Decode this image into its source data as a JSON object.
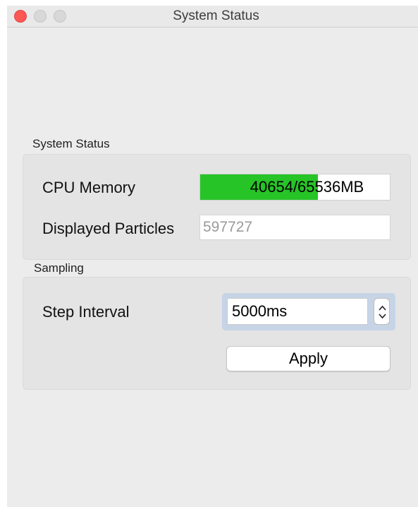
{
  "window": {
    "title": "System Status"
  },
  "system_status": {
    "group_title": "System Status",
    "cpu_memory_label": "CPU Memory",
    "cpu_memory_value": "40654/65536MB",
    "cpu_memory_fraction": 0.6203,
    "cpu_memory_bar_color": "#27c427",
    "displayed_particles_label": "Displayed Particles",
    "displayed_particles_value": "597727"
  },
  "sampling": {
    "group_title": "Sampling",
    "step_interval_label": "Step Interval",
    "step_interval_value": "5000ms",
    "apply_label": "Apply"
  },
  "icons": {
    "close": "close-icon",
    "minimize": "minimize-icon",
    "zoom": "zoom-icon",
    "stepper": "up-down-arrows-icon"
  }
}
